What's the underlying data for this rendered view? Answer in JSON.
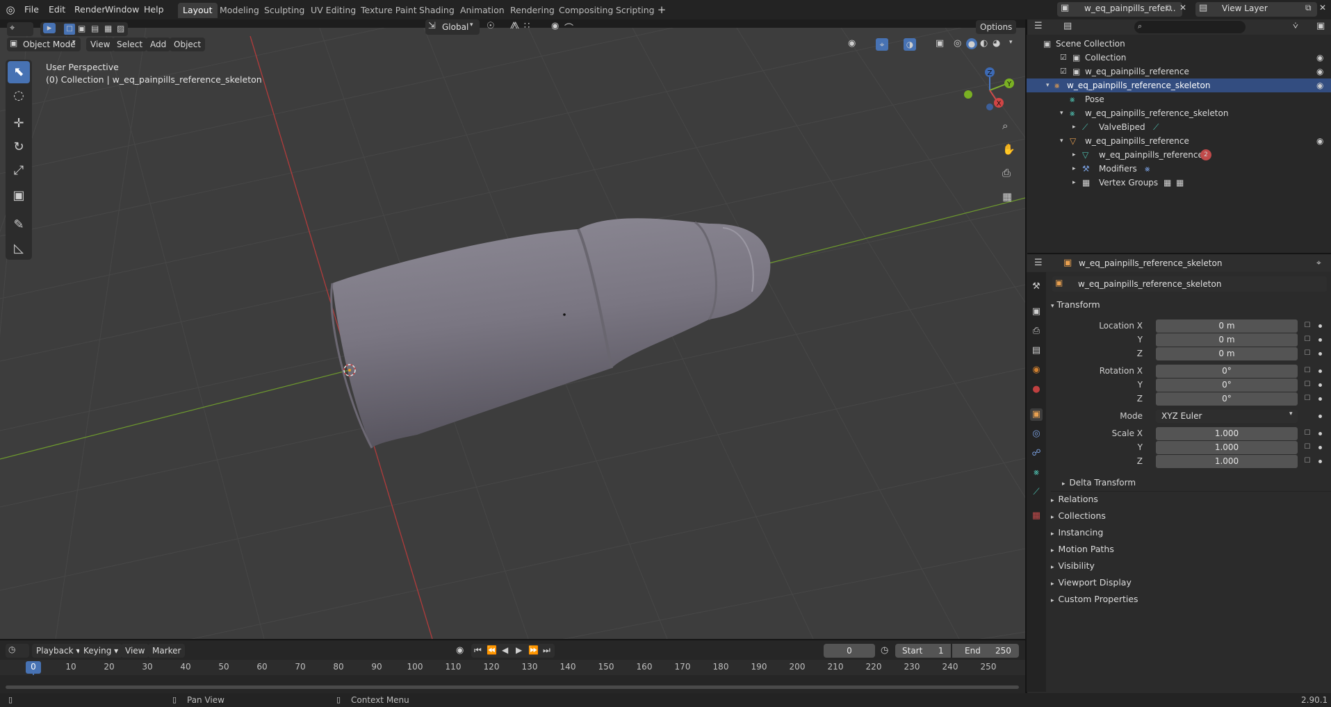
{
  "menus": [
    "File",
    "Edit",
    "Render",
    "Window",
    "Help"
  ],
  "workspaces": [
    "Layout",
    "Modeling",
    "Sculpting",
    "UV Editing",
    "Texture Paint",
    "Shading",
    "Animation",
    "Rendering",
    "Compositing",
    "Scripting"
  ],
  "active_workspace": "Layout",
  "scene_name": "w_eq_painpills_refer...",
  "view_layer": "View Layer",
  "viewport_header": {
    "mode": "Object Mode",
    "menu": [
      "View",
      "Select",
      "Add",
      "Object"
    ],
    "transform_orientation": "Global",
    "options": "Options"
  },
  "overlay_text": {
    "perspective": "User Perspective",
    "collection": "(0) Collection | w_eq_painpills_reference_skeleton"
  },
  "gizmo": {
    "z": "Z",
    "y": "Y",
    "x": "X"
  },
  "outliner": {
    "search_placeholder": "",
    "rows": [
      {
        "label": "Scene Collection",
        "icon": "scene-collection-icon"
      },
      {
        "label": "Collection",
        "icon": "collection-icon"
      },
      {
        "label": "w_eq_painpills_reference",
        "icon": "collection-icon"
      },
      {
        "label": "w_eq_painpills_reference_skeleton",
        "icon": "armature-icon"
      },
      {
        "label": "Pose",
        "icon": "pose-icon"
      },
      {
        "label": "w_eq_painpills_reference_skeleton",
        "icon": "armature-data-icon"
      },
      {
        "label": "ValveBiped",
        "icon": "bone-icon"
      },
      {
        "label": "w_eq_painpills_reference",
        "icon": "mesh-object-icon"
      },
      {
        "label": "w_eq_painpills_reference",
        "icon": "mesh-data-icon"
      },
      {
        "label": "Modifiers",
        "icon": "modifier-icon"
      },
      {
        "label": "Vertex Groups",
        "icon": "vertex-groups-icon"
      }
    ],
    "material_badge": "2"
  },
  "properties": {
    "header_object": "w_eq_painpills_reference_skeleton",
    "object_name": "w_eq_painpills_reference_skeleton",
    "transform_title": "Transform",
    "location_label": "Location X",
    "rotation_label": "Rotation X",
    "scale_label": "Scale X",
    "y_label": "Y",
    "z_label": "Z",
    "mode_label": "Mode",
    "location": [
      "0 m",
      "0 m",
      "0 m"
    ],
    "rotation": [
      "0°",
      "0°",
      "0°"
    ],
    "mode": "XYZ Euler",
    "scale": [
      "1.000",
      "1.000",
      "1.000"
    ],
    "delta_transform": "Delta Transform",
    "sections": [
      "Relations",
      "Collections",
      "Instancing",
      "Motion Paths",
      "Visibility",
      "Viewport Display",
      "Custom Properties"
    ]
  },
  "timeline": {
    "menus": [
      "Playback",
      "Keying",
      "View",
      "Marker"
    ],
    "current_frame": "0",
    "start_label": "Start",
    "start": "1",
    "end_label": "End",
    "end": "250",
    "ticks": [
      "0",
      "10",
      "20",
      "30",
      "40",
      "50",
      "60",
      "70",
      "80",
      "90",
      "100",
      "110",
      "120",
      "130",
      "140",
      "150",
      "160",
      "170",
      "180",
      "190",
      "200",
      "210",
      "220",
      "230",
      "240",
      "250"
    ]
  },
  "status": {
    "pan": "Pan View",
    "context": "Context Menu",
    "version": "2.90.1"
  }
}
